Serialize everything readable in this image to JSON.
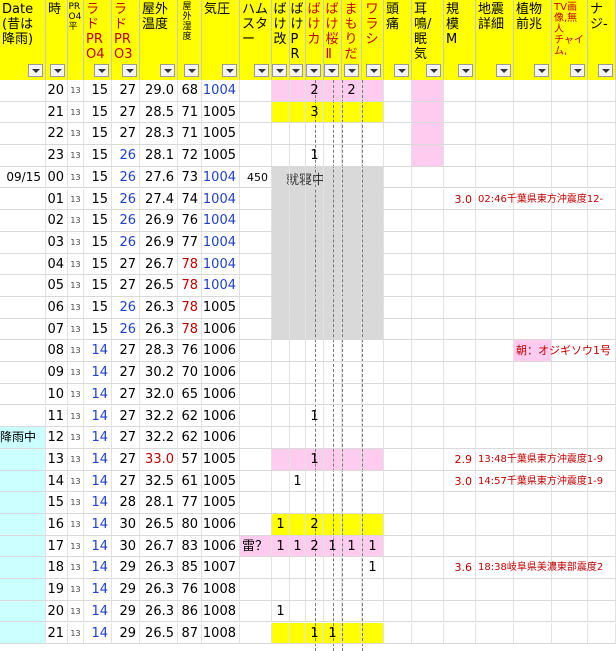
{
  "headers": [
    {
      "text": "Date\n(昔は\n降雨)",
      "style": ""
    },
    {
      "text": "時",
      "style": ""
    },
    {
      "text": "PRO4平",
      "style": "v sm"
    },
    {
      "text": "ラド\nPR\nO4",
      "style": "red"
    },
    {
      "text": "ラド\nPR\nO3",
      "style": "red"
    },
    {
      "text": "屋外\n温度",
      "style": ""
    },
    {
      "text": "屋外湿度",
      "style": "v sm"
    },
    {
      "text": "気圧",
      "style": ""
    },
    {
      "text": "ハム\nスタ\nー",
      "style": ""
    },
    {
      "text": "ばけ改",
      "style": "v"
    },
    {
      "text": "ばけPR",
      "style": "v"
    },
    {
      "text": "ばけカ",
      "style": "v red"
    },
    {
      "text": "ばけ桜Ⅱ",
      "style": "v red"
    },
    {
      "text": "まもりだ",
      "style": "v red"
    },
    {
      "text": "ワラシ",
      "style": "v red"
    },
    {
      "text": "頭\n痛",
      "style": ""
    },
    {
      "text": "耳\n鳴/眠\n気",
      "style": ""
    },
    {
      "text": "規\n模\nM",
      "style": ""
    },
    {
      "text": "地震\n詳細",
      "style": ""
    },
    {
      "text": "植物\n前兆",
      "style": ""
    },
    {
      "text": "TV画\n像,無\n人\nチャイ\nム,",
      "style": "dred"
    },
    {
      "text": "ナ\nジ-",
      "style": ""
    }
  ],
  "rows": [
    {
      "date": "",
      "hour": "20",
      "avg": "13",
      "p4": "15",
      "p3": "27",
      "temp": "29.0",
      "hum": "68",
      "pres": "1004",
      "ham": "",
      "bk": "",
      "bpr": "",
      "bka": "2",
      "bsk": "",
      "mam": "2",
      "war": "",
      "m": "",
      "eq": "",
      "plant": ""
    },
    {
      "date": "",
      "hour": "21",
      "avg": "13",
      "p4": "15",
      "p3": "27",
      "temp": "28.5",
      "hum": "71",
      "pres": "1005",
      "ham": "",
      "bk": "",
      "bpr": "",
      "bka": "3",
      "bsk": "",
      "mam": "",
      "war": "",
      "m": "",
      "eq": "",
      "plant": ""
    },
    {
      "date": "",
      "hour": "22",
      "avg": "13",
      "p4": "15",
      "p3": "27",
      "temp": "28.3",
      "hum": "71",
      "pres": "1005",
      "ham": "",
      "bk": "",
      "bpr": "",
      "bka": "",
      "bsk": "",
      "mam": "",
      "war": "",
      "m": "",
      "eq": "",
      "plant": ""
    },
    {
      "date": "",
      "hour": "23",
      "avg": "13",
      "p4": "15",
      "p3": "26",
      "temp": "28.1",
      "hum": "72",
      "pres": "1005",
      "ham": "",
      "bk": "",
      "bpr": "",
      "bka": "1",
      "bsk": "",
      "mam": "",
      "war": "",
      "m": "",
      "eq": "",
      "plant": ""
    },
    {
      "date": "09/15",
      "hour": "00",
      "avg": "13",
      "p4": "15",
      "p3": "26",
      "temp": "27.6",
      "hum": "73",
      "pres": "1004",
      "ham": "450",
      "bk": "",
      "bpr": "",
      "bka": "",
      "bsk": "",
      "mam": "",
      "war": "",
      "m": "",
      "eq": "",
      "plant": ""
    },
    {
      "date": "",
      "hour": "01",
      "avg": "13",
      "p4": "15",
      "p3": "26",
      "temp": "27.4",
      "hum": "74",
      "pres": "1004",
      "ham": "",
      "bk": "",
      "bpr": "",
      "bka": "",
      "bsk": "",
      "mam": "",
      "war": "",
      "m": "3.0",
      "eq": "02:46千葉県東方沖震度12-",
      "plant": ""
    },
    {
      "date": "",
      "hour": "02",
      "avg": "13",
      "p4": "15",
      "p3": "26",
      "temp": "26.9",
      "hum": "76",
      "pres": "1004",
      "ham": "",
      "bk": "",
      "bpr": "",
      "bka": "",
      "bsk": "",
      "mam": "",
      "war": "",
      "m": "",
      "eq": "",
      "plant": ""
    },
    {
      "date": "",
      "hour": "03",
      "avg": "13",
      "p4": "15",
      "p3": "26",
      "temp": "26.9",
      "hum": "77",
      "pres": "1004",
      "ham": "",
      "bk": "",
      "bpr": "",
      "bka": "",
      "bsk": "",
      "mam": "",
      "war": "",
      "m": "",
      "eq": "",
      "plant": ""
    },
    {
      "date": "",
      "hour": "04",
      "avg": "13",
      "p4": "15",
      "p3": "27",
      "temp": "26.7",
      "hum": "78",
      "pres": "1004",
      "ham": "",
      "bk": "",
      "bpr": "",
      "bka": "",
      "bsk": "",
      "mam": "",
      "war": "",
      "m": "",
      "eq": "",
      "plant": ""
    },
    {
      "date": "",
      "hour": "05",
      "avg": "13",
      "p4": "15",
      "p3": "27",
      "temp": "26.5",
      "hum": "78",
      "pres": "1004",
      "ham": "",
      "bk": "",
      "bpr": "",
      "bka": "",
      "bsk": "",
      "mam": "",
      "war": "",
      "m": "",
      "eq": "",
      "plant": ""
    },
    {
      "date": "",
      "hour": "06",
      "avg": "13",
      "p4": "15",
      "p3": "26",
      "temp": "26.3",
      "hum": "78",
      "pres": "1005",
      "ham": "",
      "bk": "",
      "bpr": "",
      "bka": "",
      "bsk": "",
      "mam": "",
      "war": "",
      "m": "",
      "eq": "",
      "plant": ""
    },
    {
      "date": "",
      "hour": "07",
      "avg": "13",
      "p4": "15",
      "p3": "26",
      "temp": "26.3",
      "hum": "78",
      "pres": "1006",
      "ham": "",
      "bk": "",
      "bpr": "",
      "bka": "",
      "bsk": "",
      "mam": "",
      "war": "",
      "m": "",
      "eq": "",
      "plant": ""
    },
    {
      "date": "",
      "hour": "08",
      "avg": "13",
      "p4": "14",
      "p3": "27",
      "temp": "28.3",
      "hum": "76",
      "pres": "1006",
      "ham": "",
      "bk": "",
      "bpr": "",
      "bka": "",
      "bsk": "",
      "mam": "",
      "war": "",
      "m": "",
      "eq": "",
      "plant": "朝：オジギソウ1号"
    },
    {
      "date": "",
      "hour": "09",
      "avg": "13",
      "p4": "14",
      "p3": "27",
      "temp": "30.2",
      "hum": "70",
      "pres": "1006",
      "ham": "",
      "bk": "",
      "bpr": "",
      "bka": "",
      "bsk": "",
      "mam": "",
      "war": "",
      "m": "",
      "eq": "",
      "plant": ""
    },
    {
      "date": "",
      "hour": "10",
      "avg": "13",
      "p4": "14",
      "p3": "27",
      "temp": "32.0",
      "hum": "65",
      "pres": "1006",
      "ham": "",
      "bk": "",
      "bpr": "",
      "bka": "",
      "bsk": "",
      "mam": "",
      "war": "",
      "m": "",
      "eq": "",
      "plant": ""
    },
    {
      "date": "",
      "hour": "11",
      "avg": "13",
      "p4": "14",
      "p3": "27",
      "temp": "32.2",
      "hum": "62",
      "pres": "1006",
      "ham": "",
      "bk": "",
      "bpr": "",
      "bka": "1",
      "bsk": "",
      "mam": "",
      "war": "",
      "m": "",
      "eq": "",
      "plant": ""
    },
    {
      "date": "降雨中",
      "hour": "12",
      "avg": "13",
      "p4": "14",
      "p3": "27",
      "temp": "32.2",
      "hum": "62",
      "pres": "1006",
      "ham": "",
      "bk": "",
      "bpr": "",
      "bka": "",
      "bsk": "",
      "mam": "",
      "war": "",
      "m": "",
      "eq": "",
      "plant": ""
    },
    {
      "date": "",
      "hour": "13",
      "avg": "13",
      "p4": "14",
      "p3": "27",
      "temp": "33.0",
      "hum": "57",
      "pres": "1005",
      "ham": "",
      "bk": "",
      "bpr": "",
      "bka": "1",
      "bsk": "",
      "mam": "",
      "war": "",
      "m": "2.9",
      "eq": "13:48千葉県東方沖震度1-9",
      "plant": ""
    },
    {
      "date": "",
      "hour": "14",
      "avg": "13",
      "p4": "14",
      "p3": "27",
      "temp": "32.5",
      "hum": "61",
      "pres": "1005",
      "ham": "",
      "bk": "",
      "bpr": "1",
      "bka": "",
      "bsk": "",
      "mam": "",
      "war": "",
      "m": "3.0",
      "eq": "14:57千葉県東方沖震度1-9",
      "plant": ""
    },
    {
      "date": "",
      "hour": "15",
      "avg": "13",
      "p4": "14",
      "p3": "28",
      "temp": "28.1",
      "hum": "77",
      "pres": "1005",
      "ham": "",
      "bk": "",
      "bpr": "",
      "bka": "",
      "bsk": "",
      "mam": "",
      "war": "",
      "m": "",
      "eq": "",
      "plant": ""
    },
    {
      "date": "",
      "hour": "16",
      "avg": "13",
      "p4": "14",
      "p3": "30",
      "temp": "26.5",
      "hum": "80",
      "pres": "1006",
      "ham": "",
      "bk": "1",
      "bpr": "",
      "bka": "2",
      "bsk": "",
      "mam": "",
      "war": "",
      "m": "",
      "eq": "",
      "plant": ""
    },
    {
      "date": "",
      "hour": "17",
      "avg": "13",
      "p4": "14",
      "p3": "30",
      "temp": "26.7",
      "hum": "83",
      "pres": "1006",
      "ham": "雷？",
      "bk": "1",
      "bpr": "1",
      "bka": "2",
      "bsk": "1",
      "mam": "1",
      "war": "1",
      "m": "",
      "eq": "",
      "plant": ""
    },
    {
      "date": "",
      "hour": "18",
      "avg": "13",
      "p4": "14",
      "p3": "29",
      "temp": "26.3",
      "hum": "85",
      "pres": "1007",
      "ham": "",
      "bk": "",
      "bpr": "",
      "bka": "",
      "bsk": "",
      "mam": "",
      "war": "1",
      "m": "3.6",
      "eq": "18:38岐阜県美濃東部震度2",
      "plant": ""
    },
    {
      "date": "",
      "hour": "19",
      "avg": "13",
      "p4": "14",
      "p3": "29",
      "temp": "26.3",
      "hum": "76",
      "pres": "1008",
      "ham": "",
      "bk": "",
      "bpr": "",
      "bka": "",
      "bsk": "",
      "mam": "",
      "war": "",
      "m": "",
      "eq": "",
      "plant": ""
    },
    {
      "date": "",
      "hour": "20",
      "avg": "13",
      "p4": "14",
      "p3": "29",
      "temp": "26.3",
      "hum": "86",
      "pres": "1008",
      "ham": "",
      "bk": "1",
      "bpr": "",
      "bka": "",
      "bsk": "",
      "mam": "",
      "war": "",
      "m": "",
      "eq": "",
      "plant": ""
    },
    {
      "date": "",
      "hour": "21",
      "avg": "13",
      "p4": "14",
      "p3": "29",
      "temp": "26.5",
      "hum": "87",
      "pres": "1008",
      "ham": "",
      "bk": "",
      "bpr": "",
      "bka": "1",
      "bsk": "1",
      "mam": "",
      "war": "",
      "m": "",
      "eq": "",
      "plant": ""
    }
  ],
  "sleep_label": "就寝中",
  "colors": {
    "header": "#ffff00",
    "sleep": "#d9d9d9",
    "pink": "#ffccf0",
    "cyan": "#ccffff",
    "yellow": "#ffff00",
    "blue": "#1f3fd0",
    "red": "#c00000"
  }
}
